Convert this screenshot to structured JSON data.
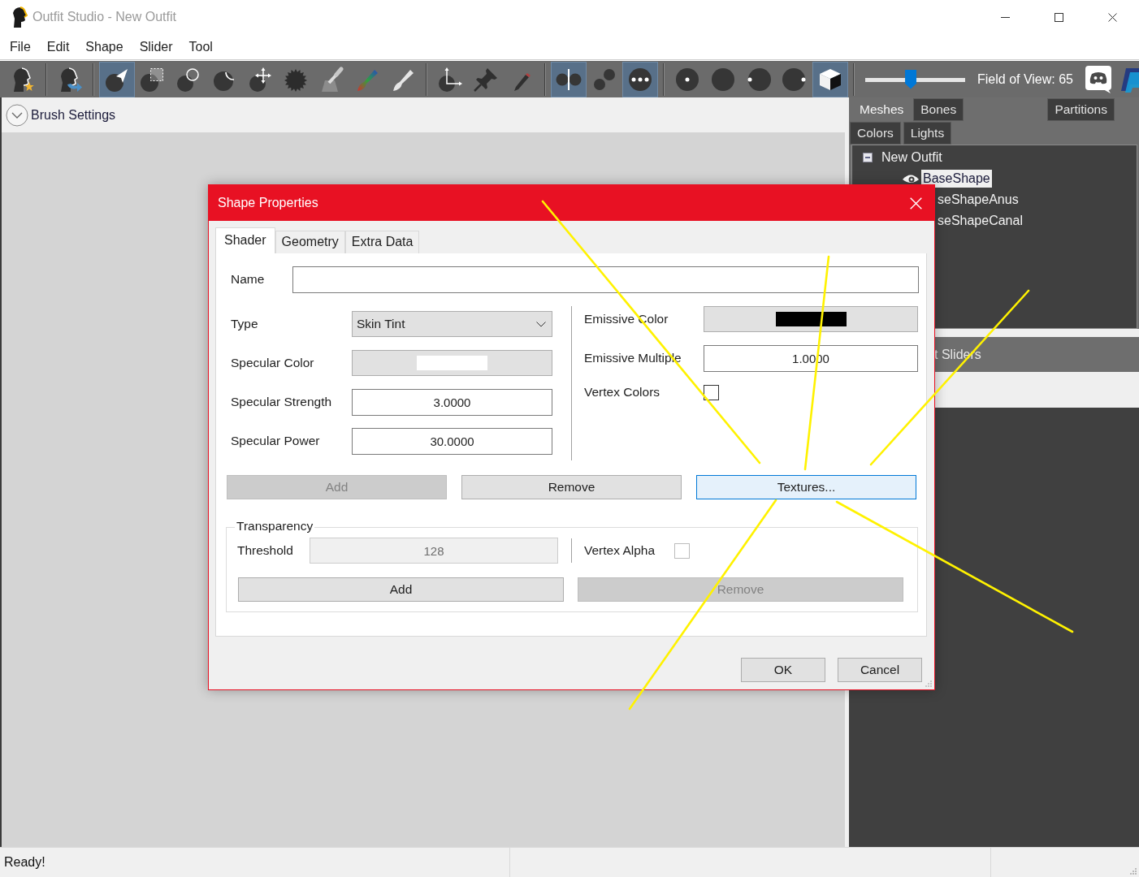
{
  "window": {
    "title": "Outfit Studio - New Outfit"
  },
  "menu": [
    "File",
    "Edit",
    "Shape",
    "Slider",
    "Tool"
  ],
  "toolbar": {
    "groups": [
      [
        {
          "kind": "reference",
          "selected": false
        }
      ],
      [
        {
          "kind": "outfit",
          "selected": false
        }
      ],
      [
        {
          "kind": "select",
          "selected": true
        },
        {
          "kind": "mask",
          "selected": false
        },
        {
          "kind": "inflate",
          "selected": false
        },
        {
          "kind": "deflate",
          "selected": false
        },
        {
          "kind": "move",
          "selected": false
        },
        {
          "kind": "smooth",
          "selected": false
        },
        {
          "kind": "weight",
          "selected": false
        },
        {
          "kind": "color",
          "selected": false
        },
        {
          "kind": "alpha",
          "selected": false
        }
      ],
      [
        {
          "kind": "transform",
          "selected": false
        },
        {
          "kind": "pin",
          "selected": false
        },
        {
          "kind": "pencil",
          "selected": false
        }
      ],
      [
        {
          "kind": "mirror",
          "selected": true
        },
        {
          "kind": "connected",
          "selected": false
        },
        {
          "kind": "dots",
          "selected": true
        }
      ],
      [
        {
          "kind": "dot",
          "selected": false
        },
        {
          "kind": "plain",
          "selected": false
        },
        {
          "kind": "dotleft",
          "selected": false
        },
        {
          "kind": "dotright",
          "selected": false
        },
        {
          "kind": "cube",
          "selected": true
        }
      ]
    ],
    "fov": {
      "level": 0.45,
      "label": "Field of View: 65"
    }
  },
  "brush_settings": {
    "label": "Brush Settings",
    "expanded": false
  },
  "panel": {
    "tab_rows": [
      {
        "left": [
          {
            "label": "Meshes",
            "selected": true
          },
          {
            "label": "Bones",
            "selected": false
          }
        ],
        "right": [
          {
            "label": "Partitions",
            "selected": false
          }
        ]
      },
      {
        "left": [
          {
            "label": "Colors",
            "selected": false
          },
          {
            "label": "Lights",
            "selected": false
          }
        ]
      }
    ],
    "tree": {
      "label": "New Outfit",
      "expanded": true,
      "children": [
        {
          "label": "BaseShape",
          "kind": "full",
          "visible": true,
          "selected": true
        },
        {
          "label": "seShapeAnus",
          "kind": "covered",
          "selected": false
        },
        {
          "label": "seShapeCanal",
          "kind": "covered",
          "selected": false
        }
      ]
    },
    "sliders_header": "t Sliders"
  },
  "dialog": {
    "title": "Shape Properties",
    "tabs": [
      {
        "label": "Shader",
        "selected": true
      },
      {
        "label": "Geometry",
        "selected": false
      },
      {
        "label": "Extra Data",
        "selected": false
      }
    ],
    "name_field": {
      "label": "Name"
    },
    "left_fields": [
      {
        "kind": "dropdown",
        "label": "Type",
        "value": "Skin Tint"
      },
      {
        "kind": "color",
        "label": "Specular Color",
        "color": "#ffffff"
      },
      {
        "kind": "number",
        "label": "Specular Strength",
        "value": "3.0000"
      },
      {
        "kind": "number",
        "label": "Specular Power",
        "value": "30.0000"
      }
    ],
    "right_fields": [
      {
        "kind": "color",
        "label": "Emissive Color",
        "color": "#000000"
      },
      {
        "kind": "number",
        "label": "Emissive Multiple",
        "value": "1.0000"
      },
      {
        "kind": "checkbox",
        "label": "Vertex Colors",
        "checked": false,
        "disabled": false
      }
    ],
    "buttons": [
      {
        "label": "Add",
        "disabled": true,
        "focused": false
      },
      {
        "label": "Remove",
        "disabled": false,
        "focused": false
      },
      {
        "label": "Textures...",
        "disabled": false,
        "focused": true
      }
    ],
    "transparency": {
      "title": "Transparency",
      "threshold": {
        "label": "Threshold",
        "value": "128",
        "disabled": true
      },
      "vertex_alpha": {
        "label": "Vertex Alpha",
        "checked": false,
        "disabled": true
      },
      "buttons": [
        {
          "label": "Add",
          "disabled": false
        },
        {
          "label": "Remove",
          "disabled": true
        }
      ]
    },
    "footer_buttons": [
      "OK",
      "Cancel"
    ]
  },
  "status_bar": {
    "text": "Ready!"
  }
}
